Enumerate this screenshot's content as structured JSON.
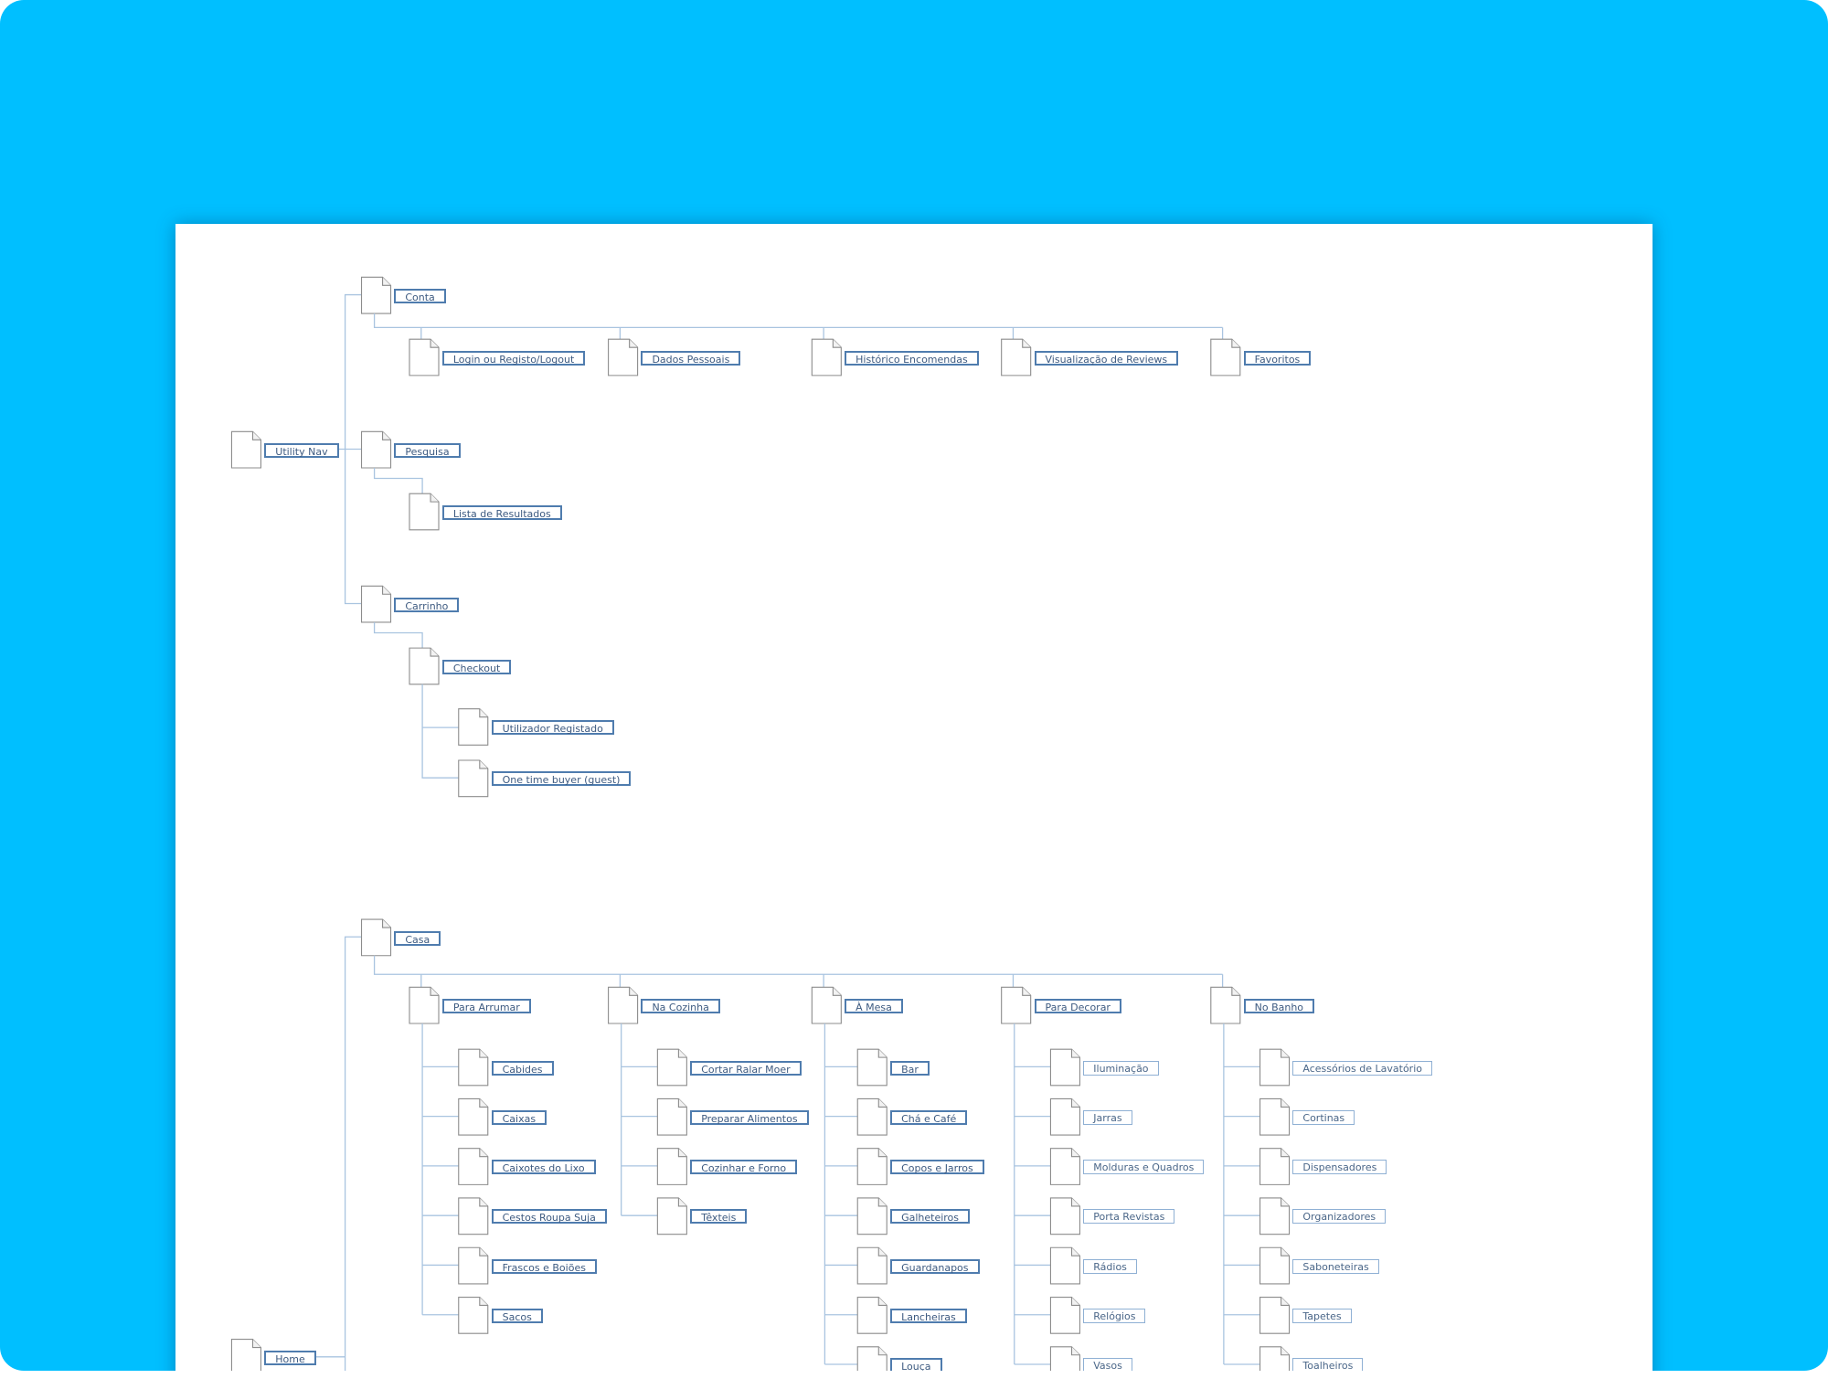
{
  "diagram": {
    "utility": {
      "label": "Utility Nav",
      "sections": [
        {
          "label": "Conta",
          "children": [
            {
              "label": "Login ou Registo/Logout"
            },
            {
              "label": "Dados Pessoais"
            },
            {
              "label": "Histórico Encomendas"
            },
            {
              "label": "Visualização de Reviews"
            },
            {
              "label": "Favoritos"
            }
          ]
        },
        {
          "label": "Pesquisa",
          "children": [
            {
              "label": "Lista de Resultados"
            }
          ]
        },
        {
          "label": "Carrinho",
          "children": [
            {
              "label": "Checkout",
              "children": [
                {
                  "label": "Utilizador Registado"
                },
                {
                  "label": "One time buyer (guest)"
                }
              ]
            }
          ]
        }
      ]
    },
    "home": {
      "label": "Home",
      "casa": {
        "label": "Casa",
        "columns": [
          {
            "label": "Para Arrumar",
            "items": [
              "Cabides",
              "Caixas",
              "Caixotes do Lixo",
              "Cestos Roupa Suja",
              "Frascos e Boiões",
              "Sacos"
            ]
          },
          {
            "label": "Na Cozinha",
            "items": [
              "Cortar Ralar Moer",
              "Preparar Alimentos",
              "Cozinhar e Forno",
              "Têxteis"
            ]
          },
          {
            "label": "À Mesa",
            "items": [
              "Bar",
              "Chá e Café",
              "Copos e Jarros",
              "Galheteiros",
              "Guardanapos",
              "Lancheiras",
              "Louça"
            ]
          },
          {
            "label": "Para Decorar",
            "items": [
              "Iluminação",
              "Jarras",
              "Molduras e Quadros",
              "Porta Revistas",
              "Rádios",
              "Relógios",
              "Vasos"
            ]
          },
          {
            "label": "No Banho",
            "items": [
              "Acessórios de Lavatório",
              "Cortinas",
              "Dispensadores",
              "Organizadores",
              "Saboneteiras",
              "Tapetes",
              "Toalheiros"
            ]
          }
        ]
      }
    }
  }
}
